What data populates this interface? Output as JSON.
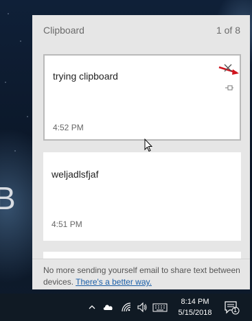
{
  "panel": {
    "title": "Clipboard",
    "count": "1 of 8"
  },
  "items": [
    {
      "text": "trying clipboard",
      "time": "4:52 PM"
    },
    {
      "text": "weljadlsfjaf",
      "time": "4:51 PM"
    }
  ],
  "footer": {
    "message": "No more sending yourself email to share text between devices.",
    "link": "There's a better way."
  },
  "wallpaper_text": "B",
  "taskbar": {
    "time": "8:14 PM",
    "date": "5/15/2018",
    "notification_count": "1"
  },
  "colors": {
    "panel_bg": "#e6e6e6",
    "card_bg": "#ffffff",
    "link": "#1a5ea8",
    "taskbar_bg": "#101a24",
    "annotation": "#d0141e"
  }
}
